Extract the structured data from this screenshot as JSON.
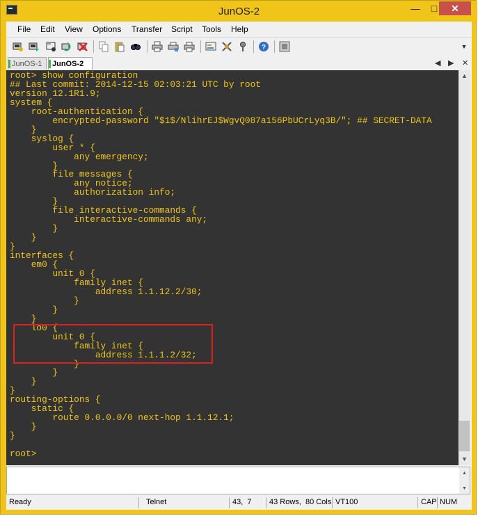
{
  "window": {
    "title": "JunOS-2",
    "minimize_glyph": "—",
    "maximize_glyph": "□",
    "close_glyph": "✕"
  },
  "menu": [
    "File",
    "Edit",
    "View",
    "Options",
    "Transfer",
    "Script",
    "Tools",
    "Help"
  ],
  "toolbar": {
    "icons": [
      "connect-icon",
      "quick-connect-icon",
      "connect-in-tab-icon",
      "reconnect-icon",
      "disconnect-icon",
      "copy-icon",
      "paste-icon",
      "find-icon",
      "print-icon",
      "print-setup-icon",
      "print-screen-icon",
      "session-options-icon",
      "global-options-icon",
      "keymap-icon",
      "help-icon",
      "sftp-icon"
    ]
  },
  "tabs": [
    {
      "label": "JunOS-1",
      "active": false
    },
    {
      "label": "JunOS-2",
      "active": true
    }
  ],
  "tab_nav": {
    "prev": "◀",
    "next": "▶",
    "close": "✕"
  },
  "terminal": {
    "lines": [
      "root> show configuration",
      "## Last commit: 2014-12-15 02:03:21 UTC by root",
      "version 12.1R1.9;",
      "system {",
      "    root-authentication {",
      "        encrypted-password \"$1$/NlihrEJ$WgvQ087a156PbUCrLyq3B/\"; ## SECRET-DATA",
      "    }",
      "    syslog {",
      "        user * {",
      "            any emergency;",
      "        }",
      "        file messages {",
      "            any notice;",
      "            authorization info;",
      "        }",
      "        file interactive-commands {",
      "            interactive-commands any;",
      "        }",
      "    }",
      "}",
      "interfaces {",
      "    em0 {",
      "        unit 0 {",
      "            family inet {",
      "                address 1.1.12.2/30;",
      "            }",
      "        }",
      "    }",
      "    lo0 {",
      "        unit 0 {",
      "            family inet {",
      "                address 1.1.1.2/32;",
      "            }",
      "        }",
      "    }",
      "}",
      "routing-options {",
      "    static {",
      "        route 0.0.0.0/0 next-hop 1.1.12.1;",
      "    }",
      "}",
      "",
      "root> "
    ],
    "text_color": "#f0c419",
    "background": "#333333",
    "highlight_color": "#e02020"
  },
  "scrollbar": {
    "up": "▲",
    "down": "▼"
  },
  "status": {
    "ready": "Ready",
    "protocol": "Telnet",
    "cursor": "43,  7",
    "size": "43 Rows,  80 Cols",
    "emulation": "VT100",
    "caps": "CAP",
    "num": "NUM"
  }
}
